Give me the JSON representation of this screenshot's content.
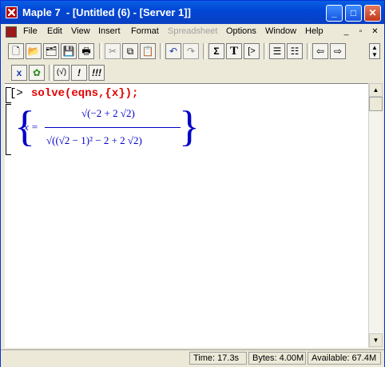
{
  "window": {
    "title": "Maple 7  - [Untitled (6) - [Server 1]]"
  },
  "title_buttons": {
    "minimize": "_",
    "maximize": "□",
    "close": "✕"
  },
  "menu": {
    "items": [
      "File",
      "Edit",
      "View",
      "Insert",
      "Format",
      "Spreadsheet",
      "Options",
      "Window",
      "Help"
    ],
    "doc_controls": [
      "_",
      "▫",
      "✕"
    ]
  },
  "toolbar1": {
    "icons": [
      "new-icon",
      "open-icon",
      "open-url-icon",
      "save-icon",
      "print-icon",
      "cut-icon",
      "copy-icon",
      "paste-icon",
      "undo-icon",
      "redo-icon",
      "sum-icon",
      "text-icon",
      "prompt-icon",
      "indent-icon",
      "outdent-icon",
      "back-icon",
      "forward-icon"
    ],
    "glyphs": {
      "sum": "Σ",
      "text": "T",
      "prompt": "[>"
    }
  },
  "toolbar2": {
    "buttons": [
      "x",
      "✿",
      "(√)",
      "!",
      "!!!"
    ]
  },
  "worksheet": {
    "prompt": "[>",
    "command": "solve(eqns,{x});",
    "result": {
      "lhs": "x =",
      "numerator": "√(−2 + 2 √2)",
      "denominator": "√((√2 − 1)² − 2 + 2 √2)"
    }
  },
  "status": {
    "time": "Time: 17.3s",
    "bytes": "Bytes: 4.00M",
    "available": "Available: 67.4M"
  },
  "colors": {
    "command": "#e00000",
    "output": "#0000c8",
    "titlebar": "#0a5fe3"
  }
}
